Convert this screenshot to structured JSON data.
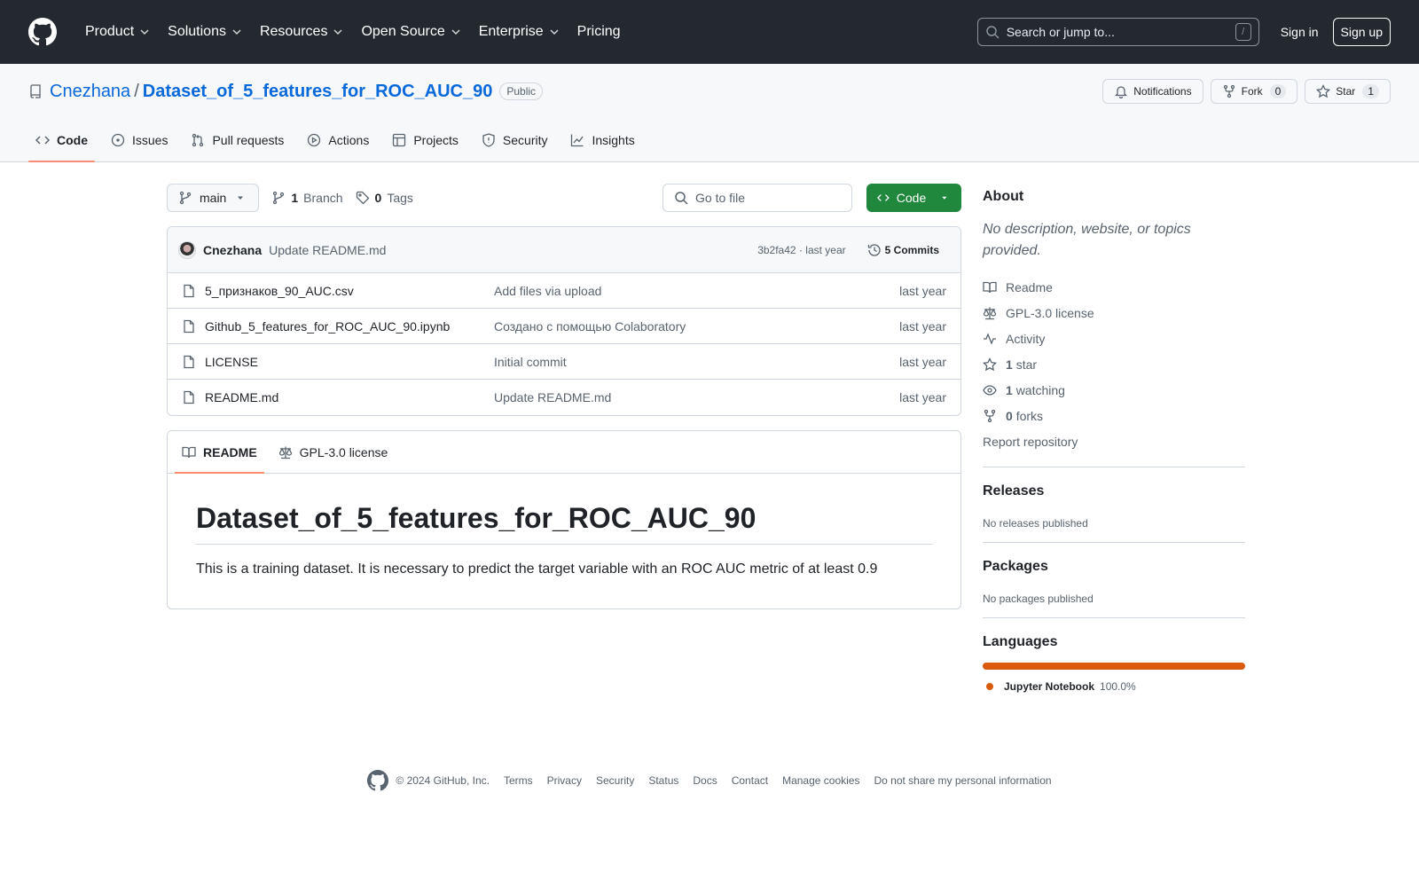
{
  "header": {
    "nav": [
      "Product",
      "Solutions",
      "Resources",
      "Open Source",
      "Enterprise",
      "Pricing"
    ],
    "search_placeholder": "Search or jump to...",
    "search_shortcut": "/",
    "sign_in": "Sign in",
    "sign_up": "Sign up"
  },
  "repo": {
    "owner": "Cnezhana",
    "separator": "/",
    "name": "Dataset_of_5_features_for_ROC_AUC_90",
    "visibility": "Public",
    "notifications_label": "Notifications",
    "fork_label": "Fork",
    "fork_count": "0",
    "star_label": "Star",
    "star_count": "1"
  },
  "tabs": [
    "Code",
    "Issues",
    "Pull requests",
    "Actions",
    "Projects",
    "Security",
    "Insights"
  ],
  "file_nav": {
    "branch": "main",
    "branch_count": "1",
    "branch_label": "Branch",
    "tag_count": "0",
    "tag_label": "Tags",
    "goto_placeholder": "Go to file",
    "code_button": "Code"
  },
  "latest_commit": {
    "author": "Cnezhana",
    "message": "Update README.md",
    "hash": "3b2fa42",
    "separator": "·",
    "time": "last year",
    "commits_label": "5 Commits"
  },
  "files": [
    {
      "name": "5_признаков_90_AUC.csv",
      "commit": "Add files via upload",
      "time": "last year"
    },
    {
      "name": "Github_5_features_for_ROC_AUC_90.ipynb",
      "commit": "Создано с помощью Colaboratory",
      "time": "last year"
    },
    {
      "name": "LICENSE",
      "commit": "Initial commit",
      "time": "last year"
    },
    {
      "name": "README.md",
      "commit": "Update README.md",
      "time": "last year"
    }
  ],
  "readme": {
    "tab_readme": "README",
    "tab_license": "GPL-3.0 license",
    "title": "Dataset_of_5_features_for_ROC_AUC_90",
    "body": "This is a training dataset. It is necessary to predict the target variable with an ROC AUC metric of at least 0.9"
  },
  "sidebar": {
    "about_title": "About",
    "about_desc": "No description, website, or topics provided.",
    "readme": "Readme",
    "license": "GPL-3.0 license",
    "activity": "Activity",
    "stars_count": "1",
    "stars_label": "star",
    "watching_count": "1",
    "watching_label": "watching",
    "forks_count": "0",
    "forks_label": "forks",
    "report": "Report repository",
    "releases_title": "Releases",
    "releases_desc": "No releases published",
    "packages_title": "Packages",
    "packages_desc": "No packages published",
    "languages_title": "Languages",
    "language_name": "Jupyter Notebook",
    "language_pct": "100.0%",
    "language_color": "#da5b0b"
  },
  "footer": {
    "copyright": "© 2024 GitHub, Inc.",
    "links": [
      "Terms",
      "Privacy",
      "Security",
      "Status",
      "Docs",
      "Contact",
      "Manage cookies",
      "Do not share my personal information"
    ]
  }
}
